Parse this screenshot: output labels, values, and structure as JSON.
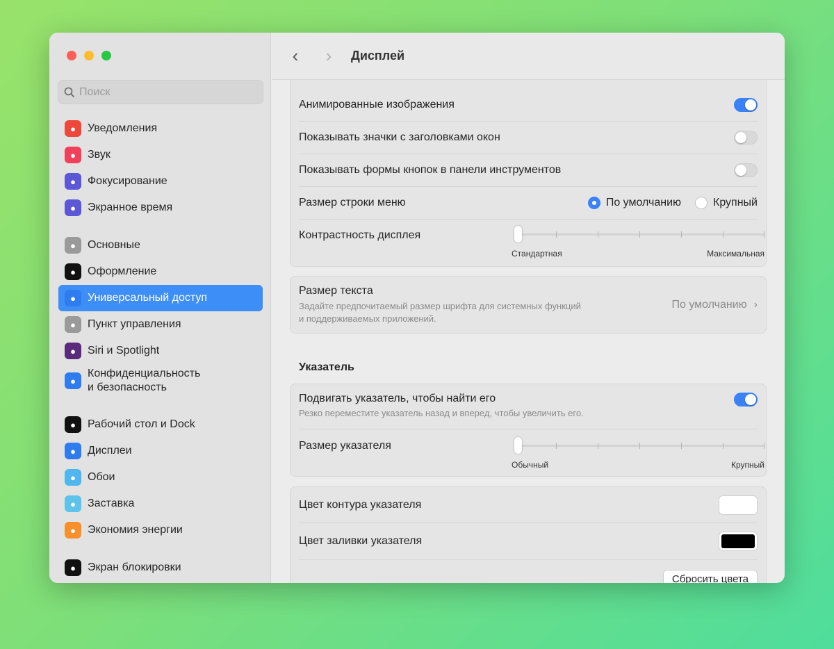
{
  "window": {
    "title": "Дисплей"
  },
  "search": {
    "placeholder": "Поиск"
  },
  "sidebar": {
    "items": [
      {
        "label": "Уведомления",
        "icon": "bell-icon",
        "color": "#f0473d"
      },
      {
        "label": "Звук",
        "icon": "speaker-icon",
        "color": "#f2405a"
      },
      {
        "label": "Фокусирование",
        "icon": "moon-icon",
        "color": "#5b57d6"
      },
      {
        "label": "Экранное время",
        "icon": "hourglass-icon",
        "color": "#5b57d6"
      },
      {
        "label": "Основные",
        "icon": "gear-icon",
        "color": "#9a9a9a"
      },
      {
        "label": "Оформление",
        "icon": "appearance-icon",
        "color": "#111111"
      },
      {
        "label": "Универсальный доступ",
        "icon": "accessibility-icon",
        "color": "#2e7cf0",
        "selected": true
      },
      {
        "label": "Пункт управления",
        "icon": "control-center-icon",
        "color": "#9a9a9a"
      },
      {
        "label": "Siri и Spotlight",
        "icon": "siri-icon",
        "color": "#5a2b7a"
      },
      {
        "label": "Конфиденциальность",
        "label2": "и безопасность",
        "icon": "hand-icon",
        "color": "#2e7cf0"
      },
      {
        "label": "Рабочий стол и Dock",
        "icon": "dock-icon",
        "color": "#111111"
      },
      {
        "label": "Дисплеи",
        "icon": "sun-icon",
        "color": "#2e7cf0"
      },
      {
        "label": "Обои",
        "icon": "flower-icon",
        "color": "#4fb6f0"
      },
      {
        "label": "Заставка",
        "icon": "screensaver-icon",
        "color": "#5ec3ea"
      },
      {
        "label": "Экономия энергии",
        "icon": "bulb-icon",
        "color": "#f7902a"
      },
      {
        "label": "Экран блокировки",
        "icon": "lock-icon",
        "color": "#111111"
      }
    ]
  },
  "display": {
    "animated_images": {
      "label": "Анимированные изображения",
      "on": true
    },
    "window_title_icons": {
      "label": "Показывать значки с заголовками окон",
      "on": false
    },
    "toolbar_button_shapes": {
      "label": "Показывать формы кнопок в панели инструментов",
      "on": false
    },
    "menu_bar_size": {
      "label": "Размер строки меню",
      "options": [
        "По умолчанию",
        "Крупный"
      ],
      "selected": "По умолчанию"
    },
    "contrast": {
      "label": "Контрастность дисплея",
      "min_label": "Стандартная",
      "max_label": "Максимальная",
      "value": 0
    },
    "text_size": {
      "label": "Размер текста",
      "desc1": "Задайте предпочитаемый размер шрифта для системных функций",
      "desc2": "и поддерживаемых приложений.",
      "value": "По умолчанию"
    }
  },
  "pointer": {
    "heading": "Указатель",
    "shake": {
      "label": "Подвигать указатель, чтобы найти его",
      "desc": "Резко переместите указатель назад и вперед, чтобы увеличить его.",
      "on": true
    },
    "size": {
      "label": "Размер указателя",
      "min_label": "Обычный",
      "max_label": "Крупный",
      "value": 0
    },
    "outline_color": {
      "label": "Цвет контура указателя",
      "color": "#ffffff"
    },
    "fill_color": {
      "label": "Цвет заливки указателя",
      "color": "#000000"
    },
    "reset_label": "Сбросить цвета"
  }
}
